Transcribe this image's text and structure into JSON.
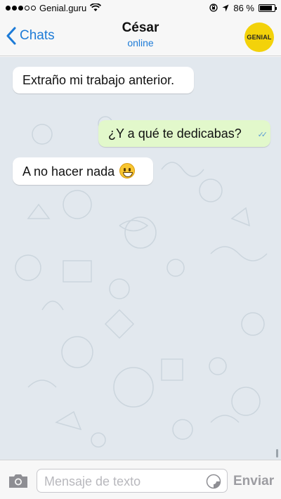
{
  "status_bar": {
    "carrier": "Genial.guru",
    "battery": "86 %",
    "battery_level": 0.86
  },
  "nav": {
    "back_label": "Chats",
    "contact_name": "César",
    "contact_status": "online",
    "avatar_text": "GENIAL"
  },
  "messages": [
    {
      "direction": "incoming",
      "text": "Extraño mi trabajo anterior."
    },
    {
      "direction": "outgoing",
      "text": "¿Y a qué te dedicabas?",
      "read_icon": "double-check-icon"
    },
    {
      "direction": "incoming",
      "text": "A no hacer nada",
      "emoji": "grinning-face-icon"
    }
  ],
  "composer": {
    "placeholder": "Mensaje de texto",
    "send_label": "Enviar"
  },
  "colors": {
    "accent": "#1d7bd7",
    "outgoing_bubble": "#e2f8cb",
    "incoming_bubble": "#ffffff",
    "chat_background": "#e2e8ee",
    "avatar": "#f3d20a"
  }
}
